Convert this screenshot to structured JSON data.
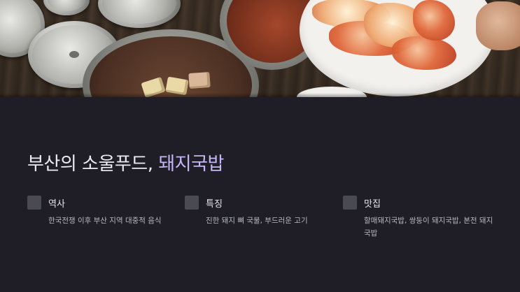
{
  "slide": {
    "hero_image": {
      "alt": "돼지국밥 반찬 (김치, 깍두기, 스테인리스 그릇)"
    },
    "title": {
      "prefix": "부산의 소울푸드, ",
      "highlight": "돼지국밥"
    },
    "features": [
      {
        "icon": "square-bullet-icon",
        "heading": "역사",
        "description": "한국전쟁 이후 부산 지역 대중적 음식"
      },
      {
        "icon": "square-bullet-icon",
        "heading": "특징",
        "description": "진한 돼지 뼈 국물, 부드러운 고기"
      },
      {
        "icon": "square-bullet-icon",
        "heading": "맛집",
        "description": "할매돼지국밥, 쌍둥이 돼지국밥, 본전 돼지국밥"
      }
    ],
    "colors": {
      "background": "#1f1e26",
      "title_text": "#ecebf2",
      "title_accent": "#c7b6f5",
      "bullet_square": "#4a4a52",
      "body_text": "#b9b8c2"
    }
  }
}
